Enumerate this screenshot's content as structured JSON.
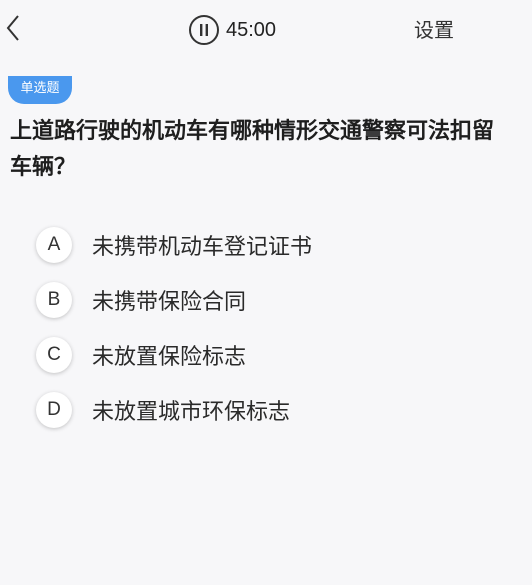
{
  "header": {
    "timer": "45:00",
    "settings_label": "设置"
  },
  "question": {
    "type_label": "单选题",
    "text": "上道路行驶的机动车有哪种情形交通警察可法扣留车辆？"
  },
  "options": [
    {
      "letter": "A",
      "text": "未携带机动车登记证书"
    },
    {
      "letter": "B",
      "text": "未携带保险合同"
    },
    {
      "letter": "C",
      "text": "未放置保险标志"
    },
    {
      "letter": "D",
      "text": "未放置城市环保标志"
    }
  ],
  "colors": {
    "accent": "#4a98ee",
    "background": "#f7f7f9"
  }
}
